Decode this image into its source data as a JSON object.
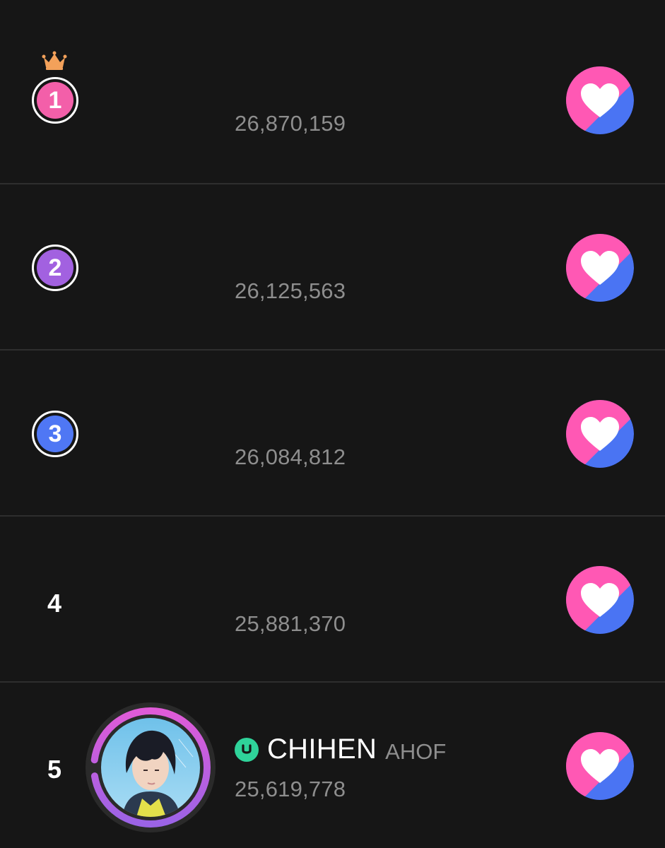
{
  "rows": [
    {
      "rank": "1",
      "votes": "26,870,159",
      "badge_color": "#f35fa9",
      "crown": true
    },
    {
      "rank": "2",
      "votes": "26,125,563",
      "badge_color": "#a261e0",
      "crown": false
    },
    {
      "rank": "3",
      "votes": "26,084,812",
      "badge_color": "#4f77f4",
      "crown": false
    },
    {
      "rank": "4",
      "votes": "25,881,370",
      "crown": false
    },
    {
      "rank": "5",
      "votes": "25,619,778",
      "artist": "CHIHEN",
      "group": "AHOF",
      "crown": false
    }
  ],
  "icons": {
    "crown": "crown-icon",
    "vote": "heart-vote-icon",
    "verified": "u-badge-icon"
  },
  "colors": {
    "background": "#161616",
    "divider": "#2e2e2e",
    "vote_pink": "#ff58b4",
    "vote_blue": "#4a74f3",
    "crown": "#f3a15a",
    "badge_green": "#2fd39a",
    "ring_pink": "#e05bd8",
    "ring_purple": "#9b63e6"
  }
}
